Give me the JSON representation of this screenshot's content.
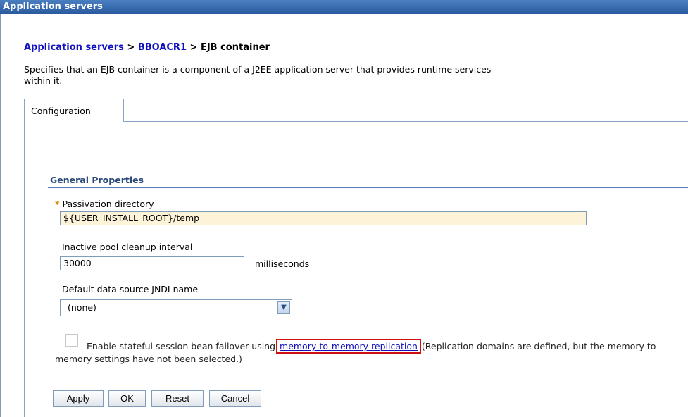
{
  "window": {
    "title": "Application servers"
  },
  "breadcrumb": {
    "link1": "Application servers",
    "sep1": " > ",
    "link2": "BBOACR1",
    "sep2": " > ",
    "current": "EJB container"
  },
  "description": {
    "line1": "Specifies that an EJB container is a component of a J2EE application server that provides runtime services",
    "line2": "within it."
  },
  "tabs": [
    {
      "label": "Configuration",
      "selected": true
    }
  ],
  "section": {
    "title": "General Properties"
  },
  "fields": {
    "passivation": {
      "required_marker": "*",
      "label": "Passivation directory",
      "value": "${USER_INSTALL_ROOT}/temp"
    },
    "cleanup": {
      "label": "Inactive pool cleanup interval",
      "value": "30000",
      "unit": "milliseconds"
    },
    "jndi": {
      "label": "Default data source JNDI name",
      "selected": "(none)"
    }
  },
  "failover": {
    "checked": false,
    "text_before": "Enable stateful session bean failover using ",
    "link": "memory-to-memory replication",
    "text_after": " (Replication domains are defined, but the memory to memory settings have not been selected.)"
  },
  "buttons": {
    "apply": "Apply",
    "ok": "OK",
    "reset": "Reset",
    "cancel": "Cancel"
  },
  "colors": {
    "titlebar": "#2a5a9e",
    "link": "#1010c0",
    "highlight_box": "#d01010",
    "required_field": "#fdf3d9"
  }
}
